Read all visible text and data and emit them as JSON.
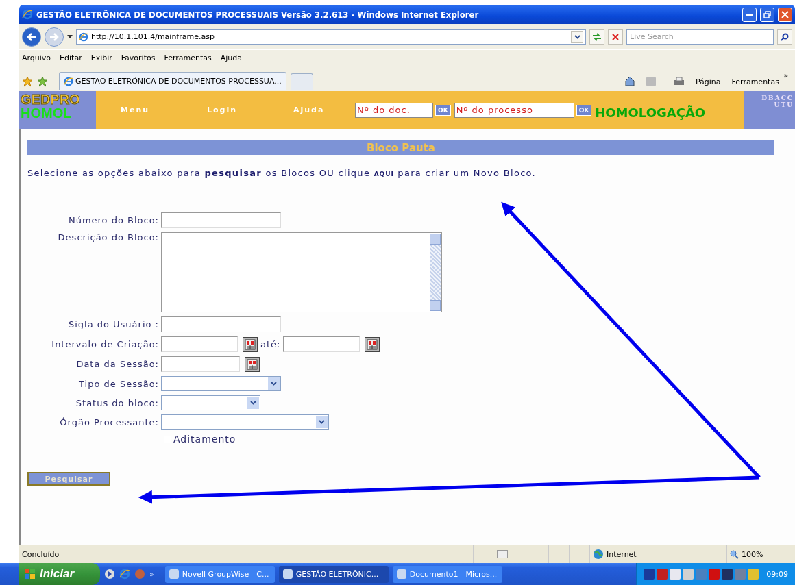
{
  "window": {
    "title": "GESTÃO ELETRÔNICA DE DOCUMENTOS PROCESSUAIS Versão 3.2.613 - Windows Internet Explorer"
  },
  "address_bar": {
    "url": "http://10.1.101.4/mainframe.asp",
    "search_placeholder": "Live Search"
  },
  "menu_bar": [
    "Arquivo",
    "Editar",
    "Exibir",
    "Favoritos",
    "Ferramentas",
    "Ajuda"
  ],
  "tabs": [
    {
      "label": "GESTÃO ELETRÔNICA DE DOCUMENTOS PROCESSUA...",
      "selected": true
    }
  ],
  "command_bar": {
    "items": [
      "Página",
      "Ferramentas"
    ],
    "more": "»"
  },
  "site_header": {
    "logo_top": "GEDPRO",
    "logo_bottom": "HOMOL",
    "nav": [
      "Menu",
      "Login",
      "Ajuda"
    ],
    "doc_field": {
      "placeholder": "Nº do doc.",
      "ok_label": "OK"
    },
    "process_field": {
      "placeholder": "Nº do processo",
      "ok_label": "OK"
    },
    "environment": "HOMOLOGAÇÃO",
    "corner": [
      "DBACC",
      "UTU"
    ]
  },
  "page": {
    "title": "Bloco Pauta",
    "intro_before": "Selecione as opções abaixo para **pesquisar** os Blocos OU clique",
    "intro_link": "AQUI",
    "intro_after": "para criar um Novo Bloco.",
    "fields": [
      {
        "kind": "text",
        "label": "Número do Bloco:"
      },
      {
        "kind": "textarea",
        "label": "Descrição do Bloco:"
      },
      {
        "kind": "text",
        "label": "Sigla do Usuário :"
      },
      {
        "kind": "date_range",
        "label": "Intervalo de Criação:",
        "separator": "até:"
      },
      {
        "kind": "date",
        "label": "Data da Sessão:"
      },
      {
        "kind": "select",
        "label": "Tipo de Sessão:"
      },
      {
        "kind": "select",
        "label": "Status do bloco:"
      },
      {
        "kind": "select",
        "label": "Órgão Processante:"
      }
    ],
    "checkbox": {
      "label": "Aditamento",
      "checked": false
    },
    "search_button": "Pesquisar"
  },
  "status_bar": {
    "status": "Concluído",
    "zone": "Internet",
    "zoom": "100%"
  },
  "taskbar": {
    "start": "Iniciar",
    "more": "»",
    "tasks": [
      {
        "label": "Novell GroupWise - C...",
        "selected": false
      },
      {
        "label": "GESTÃO ELETRÔNIC...",
        "selected": true
      },
      {
        "label": "Documento1 - Micros...",
        "selected": false
      }
    ],
    "clock": "09:09"
  }
}
